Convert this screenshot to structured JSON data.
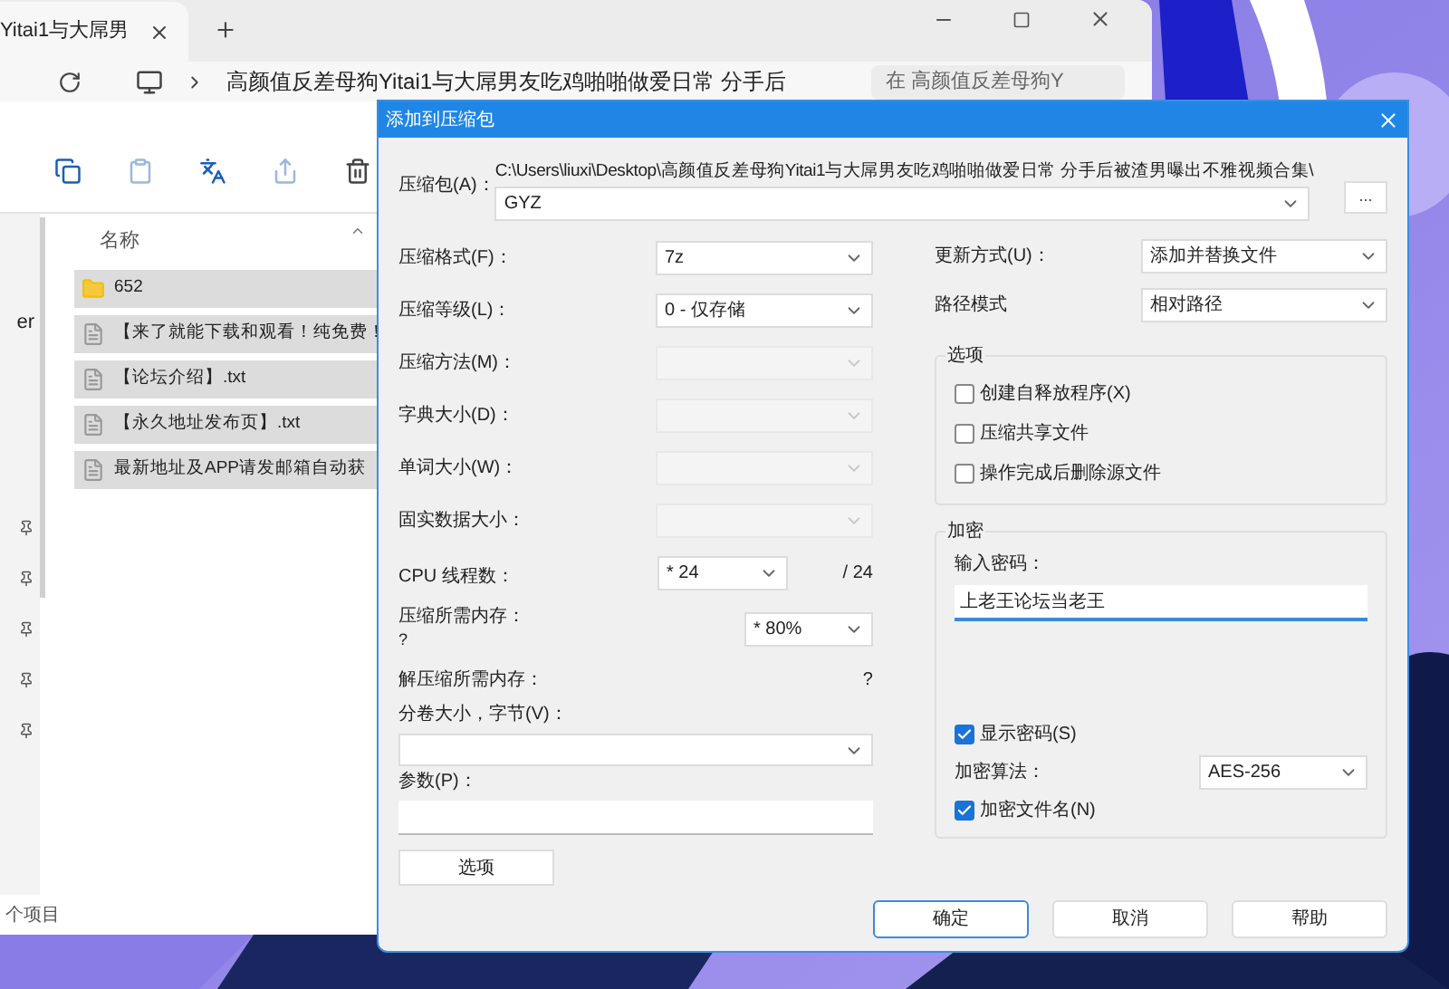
{
  "explorer": {
    "tab_title": "Yitai1与大屌男",
    "address": "高颜值反差母狗Yitai1与大屌男友吃鸡啪啪做爱日常 分手后",
    "search_placeholder": "在 高颜值反差母狗Y",
    "column_header": "名称",
    "sidebar_text": "er",
    "files": [
      {
        "kind": "folder",
        "name": "652"
      },
      {
        "kind": "file",
        "name": "【来了就能下载和观看！纯免费！"
      },
      {
        "kind": "file",
        "name": "【论坛介绍】.txt"
      },
      {
        "kind": "file",
        "name": "【永久地址发布页】.txt"
      },
      {
        "kind": "file",
        "name": "最新地址及APP请发邮箱自动获"
      }
    ],
    "status": "个项目"
  },
  "dialog": {
    "title": "添加到压缩包",
    "archive": {
      "label": "压缩包(A)：",
      "path": "C:\\Users\\liuxi\\Desktop\\高颜值反差母狗Yitai1与大屌男友吃鸡啪啪做爱日常 分手后被渣男曝出不雅视频合集\\",
      "value": "GYZ"
    },
    "browse_button": "...",
    "left_rows": [
      {
        "kind": "combo",
        "label": "压缩格式(F)：",
        "value": "7z",
        "disabled": false
      },
      {
        "kind": "combo",
        "label": "压缩等级(L)：",
        "value": "0 - 仅存储",
        "disabled": false
      },
      {
        "kind": "combo",
        "label": "压缩方法(M)：",
        "disabled": true
      },
      {
        "kind": "combo",
        "label": "字典大小(D)：",
        "disabled": true
      },
      {
        "kind": "combo",
        "label": "单词大小(W)：",
        "disabled": true
      },
      {
        "kind": "combo",
        "label": "固实数据大小：",
        "disabled": true
      },
      {
        "kind": "threads",
        "label": "CPU 线程数：",
        "value": "* 24",
        "note": "/ 24"
      },
      {
        "kind": "memory",
        "label": "压缩所需内存：",
        "note": "?",
        "value": "* 80%"
      },
      {
        "kind": "info",
        "label": "解压缩所需内存：",
        "note": "?"
      },
      {
        "kind": "stacked_combo",
        "label": "分卷大小，字节(V)："
      },
      {
        "kind": "stacked_input",
        "label": "参数(P)："
      }
    ],
    "options_button": "选项",
    "update_mode": {
      "label": "更新方式(U)：",
      "value": "添加并替换文件"
    },
    "path_mode": {
      "label": "路径模式",
      "value": "相对路径"
    },
    "options_group": {
      "title": "选项",
      "items": [
        {
          "label": "创建自释放程序(X)",
          "checked": false
        },
        {
          "label": "压缩共享文件",
          "checked": false
        },
        {
          "label": "操作完成后删除源文件",
          "checked": false
        }
      ]
    },
    "encryption": {
      "title": "加密",
      "password_label": "输入密码：",
      "password": "上老王论坛当老王",
      "show_password": {
        "label": "显示密码(S)",
        "checked": true
      },
      "method_label": "加密算法：",
      "method": "AES-256",
      "encrypt_names": {
        "label": "加密文件名(N)",
        "checked": true
      }
    },
    "buttons": [
      {
        "label": "确定",
        "default": true
      },
      {
        "label": "取消",
        "default": false
      },
      {
        "label": "帮助",
        "default": false
      }
    ]
  }
}
